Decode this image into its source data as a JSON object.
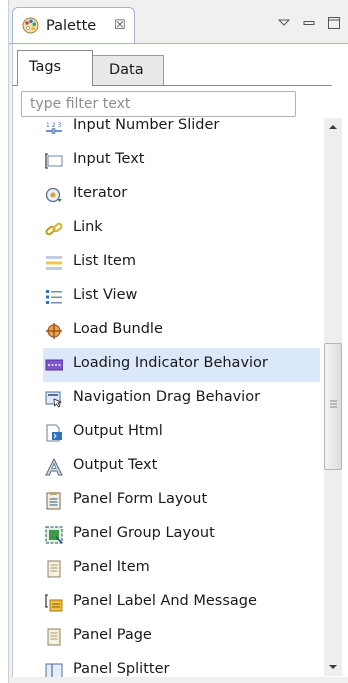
{
  "view": {
    "title": "Palette",
    "close_glyph": "☒"
  },
  "inner_tabs": [
    {
      "label": "Tags"
    },
    {
      "label": "Data"
    }
  ],
  "filter": {
    "placeholder": "type filter text",
    "value": ""
  },
  "items": [
    {
      "label": "Input Number Slider",
      "icon": "number-slider-icon"
    },
    {
      "label": "Input Text",
      "icon": "input-text-icon"
    },
    {
      "label": "Iterator",
      "icon": "iterator-icon"
    },
    {
      "label": "Link",
      "icon": "link-icon"
    },
    {
      "label": "List Item",
      "icon": "list-item-icon"
    },
    {
      "label": "List View",
      "icon": "list-view-icon"
    },
    {
      "label": "Load Bundle",
      "icon": "load-bundle-icon"
    },
    {
      "label": "Loading Indicator Behavior",
      "icon": "loading-indicator-icon"
    },
    {
      "label": "Navigation Drag Behavior",
      "icon": "navigation-drag-icon"
    },
    {
      "label": "Output Html",
      "icon": "output-html-icon"
    },
    {
      "label": "Output Text",
      "icon": "output-text-icon"
    },
    {
      "label": "Panel Form Layout",
      "icon": "panel-form-layout-icon"
    },
    {
      "label": "Panel Group Layout",
      "icon": "panel-group-layout-icon"
    },
    {
      "label": "Panel Item",
      "icon": "panel-item-icon"
    },
    {
      "label": "Panel Label And Message",
      "icon": "panel-label-message-icon"
    },
    {
      "label": "Panel Page",
      "icon": "panel-page-icon"
    },
    {
      "label": "Panel Splitter",
      "icon": "panel-splitter-icon"
    }
  ],
  "selected_item": "Loading Indicator Behavior",
  "colors": {
    "selection": "#dbe8f9",
    "border": "#a7b3c6"
  }
}
